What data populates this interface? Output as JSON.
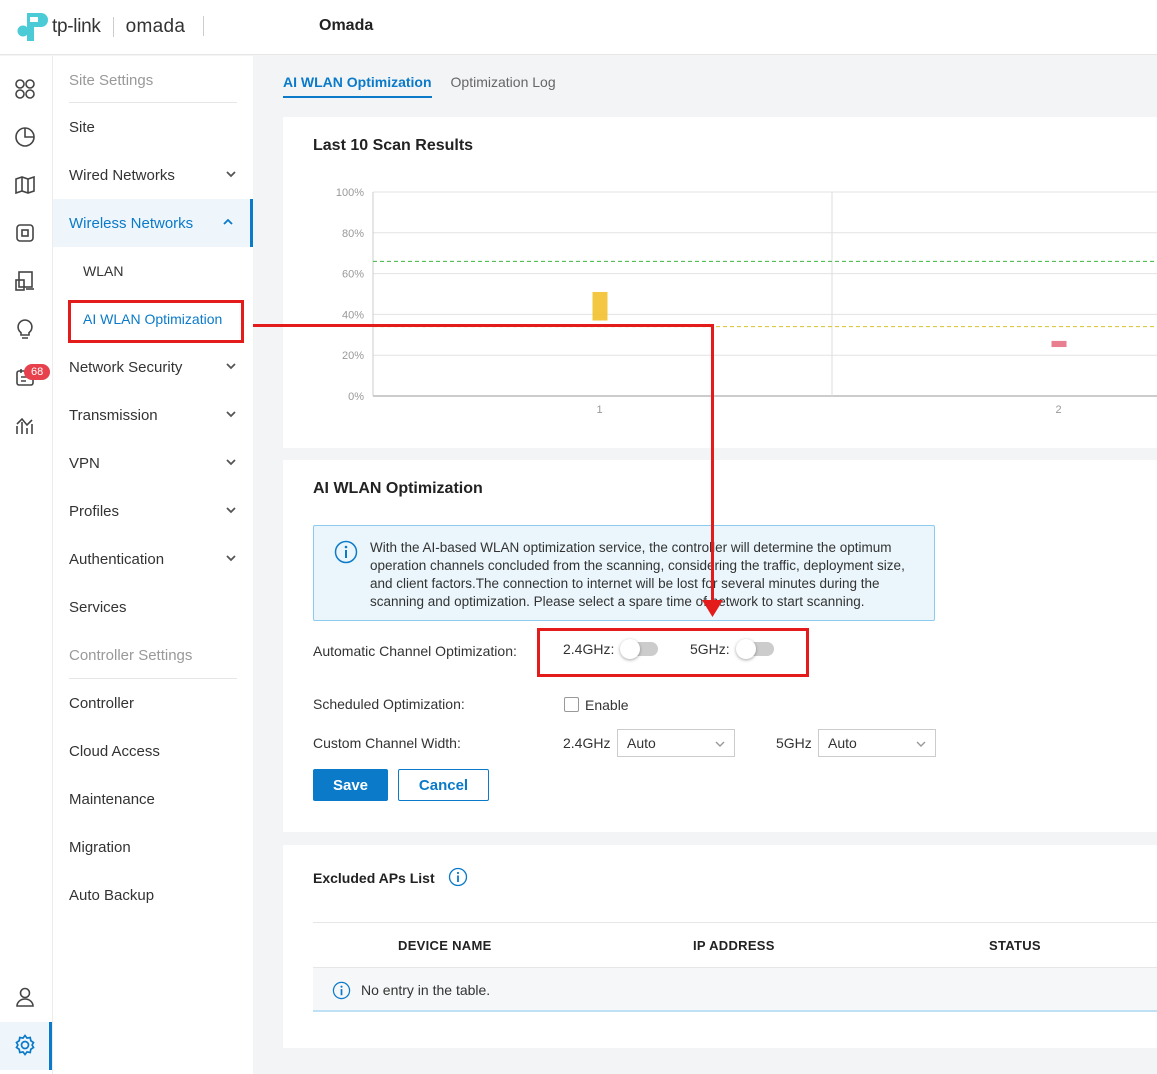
{
  "header": {
    "brand": "tp-link",
    "product": "omada",
    "site_name": "Omada"
  },
  "rail": {
    "badge_count": "68",
    "icons": [
      "dashboard-icon",
      "statistics-icon",
      "map-icon",
      "devices-icon",
      "clients-icon",
      "insights-icon",
      "logs-icon",
      "reports-icon",
      "account-icon",
      "settings-icon"
    ]
  },
  "sidebar": {
    "site_settings_heading": "Site Settings",
    "site": "Site",
    "wired_networks": "Wired Networks",
    "wireless_networks": "Wireless Networks",
    "wlan": "WLAN",
    "ai_wlan_optimization": "AI WLAN Optimization",
    "network_security": "Network Security",
    "transmission": "Transmission",
    "vpn": "VPN",
    "profiles": "Profiles",
    "authentication": "Authentication",
    "services": "Services",
    "controller_settings_heading": "Controller Settings",
    "controller": "Controller",
    "cloud_access": "Cloud Access",
    "maintenance": "Maintenance",
    "migration": "Migration",
    "auto_backup": "Auto Backup"
  },
  "tabs": [
    {
      "label": "AI WLAN Optimization",
      "active": true
    },
    {
      "label": "Optimization Log",
      "active": false
    }
  ],
  "scan_results": {
    "title": "Last 10 Scan Results"
  },
  "chart_data": {
    "type": "bar",
    "categories": [
      "1",
      "2"
    ],
    "y_ticks": [
      "100%",
      "80%",
      "60%",
      "40%",
      "20%",
      "0%"
    ],
    "ylim": [
      0,
      100
    ],
    "series": [
      {
        "color": "#f2c12e",
        "values": [
          {
            "x": "1",
            "low": 37,
            "high": 51
          }
        ]
      },
      {
        "color": "#e87085",
        "values": [
          {
            "x": "2",
            "low": 24,
            "high": 27
          }
        ]
      }
    ],
    "threshold_lines": [
      {
        "value": 66,
        "color": "#3cb43c",
        "style": "dashed"
      },
      {
        "value": 34,
        "color": "#d8c22a",
        "style": "dashed"
      }
    ],
    "grid": true
  },
  "optimization": {
    "title": "AI WLAN Optimization",
    "info_text": "With the AI-based WLAN optimization service, the controller will determine the optimum operation channels concluded from the scanning, considering the traffic, deployment size, and client factors.The connection to internet will be lost for several minutes during the scanning and optimization. Please select a spare time of network to start scanning.",
    "auto_channel_label": "Automatic Channel Optimization:",
    "band_24_label": "2.4GHz:",
    "band_5_label": "5GHz:",
    "toggle_24_on": false,
    "toggle_5_on": false,
    "scheduled_label": "Scheduled Optimization:",
    "enable_label": "Enable",
    "enable_checked": false,
    "channel_width_label": "Custom Channel Width:",
    "width_24_label": "2.4GHz",
    "width_24_value": "Auto",
    "width_5_label": "5GHz",
    "width_5_value": "Auto",
    "save_label": "Save",
    "cancel_label": "Cancel"
  },
  "excluded": {
    "title": "Excluded APs List",
    "columns": [
      "DEVICE NAME",
      "IP ADDRESS",
      "STATUS"
    ],
    "empty_text": "No entry in the table."
  },
  "colors": {
    "accent": "#0a7ac9",
    "annotation": "#e41b1b"
  }
}
